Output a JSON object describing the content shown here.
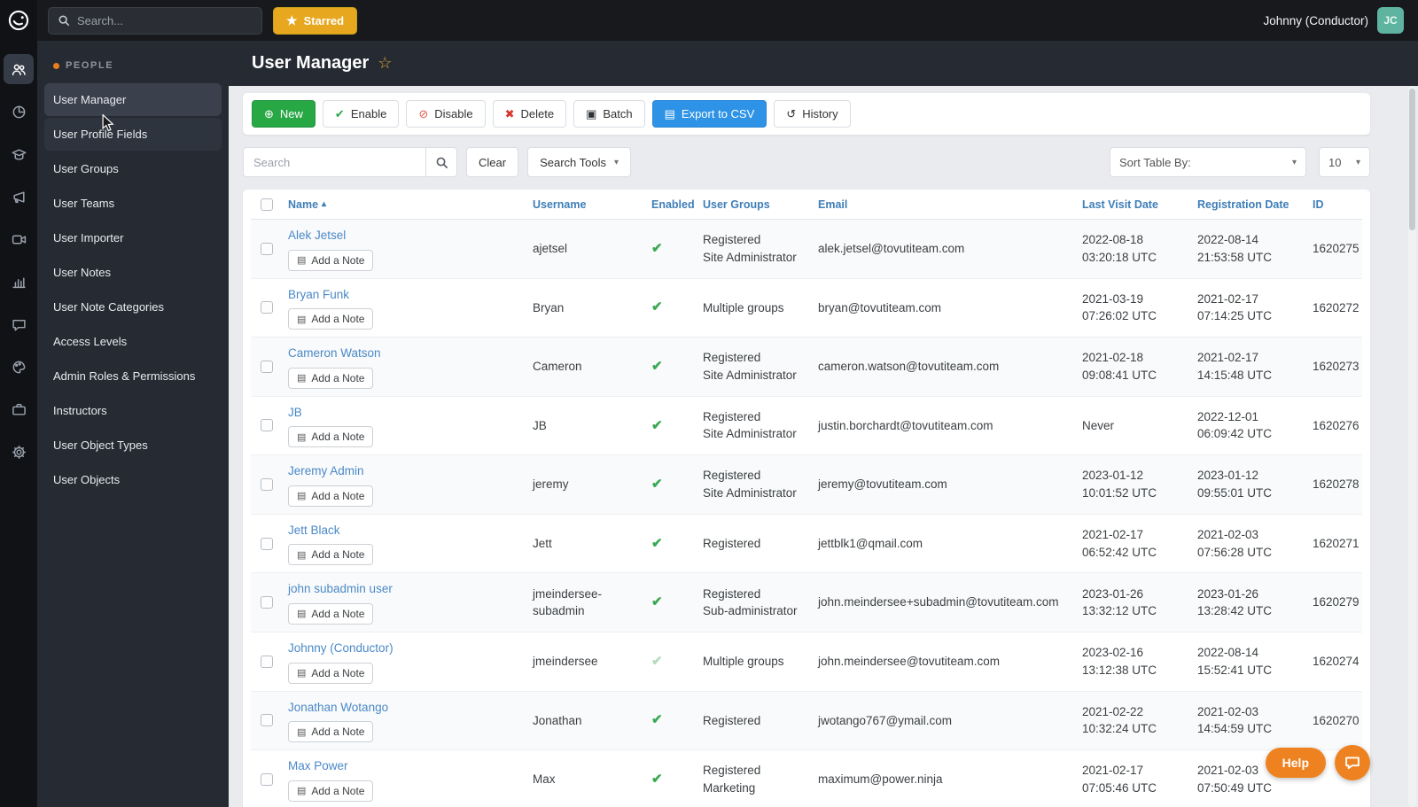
{
  "topbar": {
    "search_placeholder": "Search...",
    "starred_label": "Starred",
    "user_name": "Johnny (Conductor)",
    "avatar_initials": "JC"
  },
  "rail": {
    "icons": [
      "users-icon",
      "pie-chart-icon",
      "graduation-cap-icon",
      "megaphone-icon",
      "video-icon",
      "bar-chart-icon",
      "chat-icon",
      "palette-icon",
      "briefcase-icon",
      "gear-icon"
    ]
  },
  "sidebar": {
    "section": "PEOPLE",
    "items": [
      {
        "label": "User Manager",
        "state": "active"
      },
      {
        "label": "User Profile Fields",
        "state": "hover"
      },
      {
        "label": "User Groups",
        "state": ""
      },
      {
        "label": "User Teams",
        "state": ""
      },
      {
        "label": "User Importer",
        "state": ""
      },
      {
        "label": "User Notes",
        "state": ""
      },
      {
        "label": "User Note Categories",
        "state": ""
      },
      {
        "label": "Access Levels",
        "state": ""
      },
      {
        "label": "Admin Roles & Permissions",
        "state": ""
      },
      {
        "label": "Instructors",
        "state": ""
      },
      {
        "label": "User Object Types",
        "state": ""
      },
      {
        "label": "User Objects",
        "state": ""
      }
    ]
  },
  "header": {
    "title": "User Manager"
  },
  "toolbar": {
    "buttons": [
      {
        "name": "new-button",
        "label": "New",
        "style": "btn-success",
        "icon": "plus-circle-icon",
        "icon_color": "#ffffff"
      },
      {
        "name": "enable-button",
        "label": "Enable",
        "style": "btn-light",
        "icon": "check-icon",
        "icon_color": "#2ea44f"
      },
      {
        "name": "disable-button",
        "label": "Disable",
        "style": "btn-light",
        "icon": "disable-icon",
        "icon_color": "#e2574c"
      },
      {
        "name": "delete-button",
        "label": "Delete",
        "style": "btn-light",
        "icon": "x-icon",
        "icon_color": "#d9342b"
      },
      {
        "name": "batch-button",
        "label": "Batch",
        "style": "btn-light",
        "icon": "batch-icon",
        "icon_color": "#2f3337"
      },
      {
        "name": "export-csv-button",
        "label": "Export to CSV",
        "style": "btn-primary",
        "icon": "file-icon",
        "icon_color": "#ffffff"
      },
      {
        "name": "history-button",
        "label": "History",
        "style": "btn-light",
        "icon": "history-icon",
        "icon_color": "#2f3337"
      }
    ]
  },
  "filters": {
    "search_placeholder": "Search",
    "clear_label": "Clear",
    "search_tools_label": "Search Tools",
    "sort_label": "Sort Table By:",
    "page_size": "10"
  },
  "table": {
    "columns": [
      "Name",
      "Username",
      "Enabled",
      "User Groups",
      "Email",
      "Last Visit Date",
      "Registration Date",
      "ID"
    ],
    "sorted_column": "Name",
    "sort_direction": "asc",
    "add_note_label": "Add a Note",
    "rows": [
      {
        "name": "Alek Jetsel",
        "username": "ajetsel",
        "enabled": true,
        "enabled_muted": false,
        "groups": [
          "Registered",
          "Site Administrator"
        ],
        "email": "alek.jetsel@tovutiteam.com",
        "last_visit": "2022-08-18 03:20:18 UTC",
        "registered": "2022-08-14 21:53:58 UTC",
        "id": "1620275"
      },
      {
        "name": "Bryan Funk",
        "username": "Bryan",
        "enabled": true,
        "enabled_muted": false,
        "groups": [
          "Multiple groups"
        ],
        "email": "bryan@tovutiteam.com",
        "last_visit": "2021-03-19 07:26:02 UTC",
        "registered": "2021-02-17 07:14:25 UTC",
        "id": "1620272"
      },
      {
        "name": "Cameron Watson",
        "username": "Cameron",
        "enabled": true,
        "enabled_muted": false,
        "groups": [
          "Registered",
          "Site Administrator"
        ],
        "email": "cameron.watson@tovutiteam.com",
        "last_visit": "2021-02-18 09:08:41 UTC",
        "registered": "2021-02-17 14:15:48 UTC",
        "id": "1620273"
      },
      {
        "name": "JB",
        "username": "JB",
        "enabled": true,
        "enabled_muted": false,
        "groups": [
          "Registered",
          "Site Administrator"
        ],
        "email": "justin.borchardt@tovutiteam.com",
        "last_visit": "Never",
        "registered": "2022-12-01 06:09:42 UTC",
        "id": "1620276"
      },
      {
        "name": "Jeremy Admin",
        "username": "jeremy",
        "enabled": true,
        "enabled_muted": false,
        "groups": [
          "Registered",
          "Site Administrator"
        ],
        "email": "jeremy@tovutiteam.com",
        "last_visit": "2023-01-12 10:01:52 UTC",
        "registered": "2023-01-12 09:55:01 UTC",
        "id": "1620278"
      },
      {
        "name": "Jett Black",
        "username": "Jett",
        "enabled": true,
        "enabled_muted": false,
        "groups": [
          "Registered"
        ],
        "email": "jettblk1@qmail.com",
        "last_visit": "2021-02-17 06:52:42 UTC",
        "registered": "2021-02-03 07:56:28 UTC",
        "id": "1620271"
      },
      {
        "name": "john subadmin user",
        "username": "jmeindersee-subadmin",
        "enabled": true,
        "enabled_muted": false,
        "groups": [
          "Registered",
          "Sub-administrator"
        ],
        "email": "john.meindersee+subadmin@tovutiteam.com",
        "last_visit": "2023-01-26 13:32:12 UTC",
        "registered": "2023-01-26 13:28:42 UTC",
        "id": "1620279"
      },
      {
        "name": "Johnny (Conductor)",
        "username": "jmeindersee",
        "enabled": true,
        "enabled_muted": true,
        "groups": [
          "Multiple groups"
        ],
        "email": "john.meindersee@tovutiteam.com",
        "last_visit": "2023-02-16 13:12:38 UTC",
        "registered": "2022-08-14 15:52:41 UTC",
        "id": "1620274"
      },
      {
        "name": "Jonathan Wotango",
        "username": "Jonathan",
        "enabled": true,
        "enabled_muted": false,
        "groups": [
          "Registered"
        ],
        "email": "jwotango767@ymail.com",
        "last_visit": "2021-02-22 10:32:24 UTC",
        "registered": "2021-02-03 14:54:59 UTC",
        "id": "1620270"
      },
      {
        "name": "Max Power",
        "username": "Max",
        "enabled": true,
        "enabled_muted": false,
        "groups": [
          "Registered",
          "Marketing"
        ],
        "email": "maximum@power.ninja",
        "last_visit": "2021-02-17 07:05:46 UTC",
        "registered": "2021-02-03 07:50:49 UTC",
        "id": ""
      }
    ]
  },
  "help": {
    "label": "Help"
  }
}
